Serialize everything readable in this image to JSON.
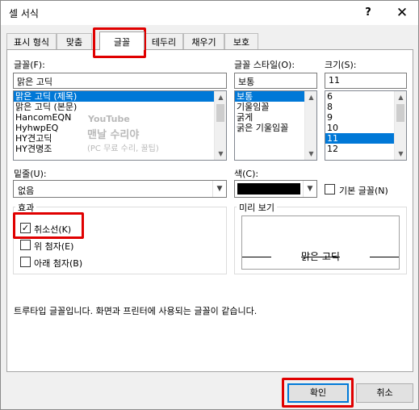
{
  "window": {
    "title": "셀 서식",
    "help_label": "?",
    "close_label": "✕"
  },
  "tabs": [
    {
      "label": "표시 형식"
    },
    {
      "label": "맞춤"
    },
    {
      "label": "글꼴"
    },
    {
      "label": "테두리"
    },
    {
      "label": "채우기"
    },
    {
      "label": "보호"
    }
  ],
  "font": {
    "label": "글꼴(F):",
    "value": "맑은 고딕",
    "items": [
      "맑은 고딕 (제목)",
      "맑은 고딕 (본문)",
      "HancomEQN",
      "HyhwpEQ",
      "HY견고딕",
      "HY견명조"
    ]
  },
  "style": {
    "label": "글꼴 스타일(O):",
    "value": "보통",
    "items": [
      "보통",
      "기울임꼴",
      "굵게",
      "굵은 기울임꼴"
    ]
  },
  "size": {
    "label": "크기(S):",
    "value": "11",
    "items": [
      "6",
      "8",
      "9",
      "10",
      "11",
      "12"
    ]
  },
  "underline": {
    "label": "밑줄(U):",
    "value": "없음"
  },
  "color": {
    "label": "색(C):",
    "swatch": "#000000",
    "normal_font_label": "기본 글꼴(N)"
  },
  "effects": {
    "title": "효과",
    "strikethrough": "취소선(K)",
    "superscript": "위 첨자(E)",
    "subscript": "아래 첨자(B)",
    "check_mark": "✓"
  },
  "preview": {
    "title": "미리 보기",
    "sample": "맑은 고딕"
  },
  "note": "트루타입 글꼴입니다. 화면과 프린터에 사용되는 글꼴이 같습니다.",
  "buttons": {
    "ok": "확인",
    "cancel": "취소"
  },
  "watermark": {
    "line1": "YouTube",
    "line2": "맨날 수리야",
    "line3": "(PC 무료 수리, 꿀팁)"
  },
  "colors": {
    "selection": "#0078d7",
    "highlight": "#e00000"
  }
}
